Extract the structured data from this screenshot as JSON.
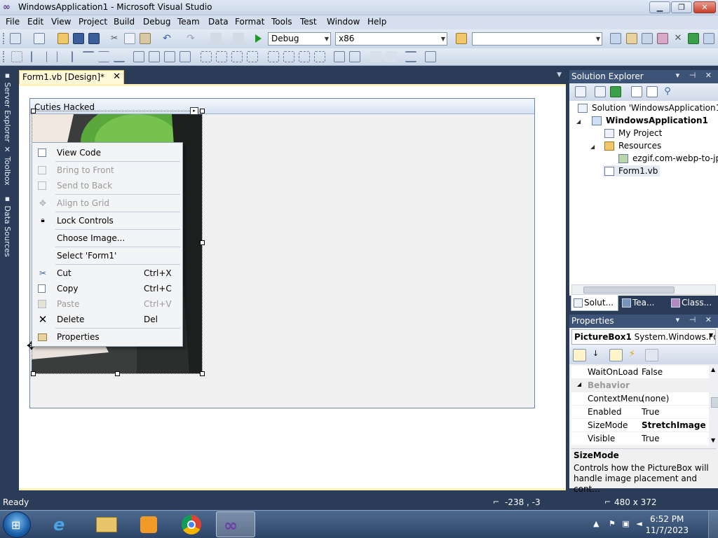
{
  "window": {
    "title": "WindowsApplication1 - Microsoft Visual Studio",
    "minimize_glyph": "▁",
    "maximize_glyph": "❐",
    "close_glyph": "✕"
  },
  "menu": [
    "File",
    "Edit",
    "View",
    "Project",
    "Build",
    "Debug",
    "Team",
    "Data",
    "Format",
    "Tools",
    "Test",
    "Window",
    "Help"
  ],
  "toolbar": {
    "config": "Debug",
    "platform": "x86",
    "find_value": ""
  },
  "side_tabs": [
    "Server Explorer",
    "Toolbox",
    "Data Sources"
  ],
  "document": {
    "tab_label": "Form1.vb [Design]*",
    "tab_close": "✕"
  },
  "form": {
    "caption": "Cuties Hacked"
  },
  "context_menu": {
    "items": [
      {
        "label": "View Code",
        "shortcut": "",
        "enabled": true,
        "icon": "view-code-icon"
      },
      {
        "label": "Bring to Front",
        "shortcut": "",
        "enabled": false,
        "icon": "bring-to-front-icon"
      },
      {
        "label": "Send to Back",
        "shortcut": "",
        "enabled": false,
        "icon": "send-to-back-icon"
      },
      {
        "label": "Align to Grid",
        "shortcut": "",
        "enabled": false,
        "icon": "align-to-grid-icon"
      },
      {
        "label": "Lock Controls",
        "shortcut": "",
        "enabled": true,
        "icon": "lock-icon"
      },
      {
        "label": "Choose Image...",
        "shortcut": "",
        "enabled": true,
        "icon": ""
      },
      {
        "label": "Select 'Form1'",
        "shortcut": "",
        "enabled": true,
        "icon": ""
      },
      {
        "label": "Cut",
        "shortcut": "Ctrl+X",
        "enabled": true,
        "icon": "scissors-icon"
      },
      {
        "label": "Copy",
        "shortcut": "Ctrl+C",
        "enabled": true,
        "icon": "copy-icon"
      },
      {
        "label": "Paste",
        "shortcut": "Ctrl+V",
        "enabled": false,
        "icon": "paste-icon"
      },
      {
        "label": "Delete",
        "shortcut": "Del",
        "enabled": true,
        "icon": "delete-icon"
      },
      {
        "label": "Properties",
        "shortcut": "",
        "enabled": true,
        "icon": "properties-icon"
      }
    ]
  },
  "solution_explorer": {
    "title": "Solution Explorer",
    "header_buttons": "▾ ⊣ ✕",
    "tree": [
      {
        "label": "Solution 'WindowsApplication1'",
        "bold": false
      },
      {
        "label": "WindowsApplication1",
        "bold": true
      },
      {
        "label": "My Project",
        "bold": false
      },
      {
        "label": "Resources",
        "bold": false
      },
      {
        "label": "ezgif.com-webp-to-jp",
        "bold": false
      },
      {
        "label": "Form1.vb",
        "bold": false
      }
    ],
    "tabs": [
      "Solut...",
      "Tea...",
      "Class..."
    ]
  },
  "properties": {
    "title": "Properties",
    "header_buttons": "▾ ⊣ ✕",
    "object_name": "PictureBox1",
    "object_type": "System.Windows.For",
    "rows": [
      {
        "name": "WaitOnLoad",
        "value": "False",
        "category": false,
        "bold": false
      },
      {
        "name": "Behavior",
        "value": "",
        "category": true,
        "bold": false
      },
      {
        "name": "ContextMenu",
        "value": "(none)",
        "category": false,
        "bold": false
      },
      {
        "name": "Enabled",
        "value": "True",
        "category": false,
        "bold": false
      },
      {
        "name": "SizeMode",
        "value": "StretchImage",
        "category": false,
        "bold": true
      },
      {
        "name": "Visible",
        "value": "True",
        "category": false,
        "bold": false
      }
    ],
    "description_title": "SizeMode",
    "description_text": "Controls how the PictureBox will handle image placement and cont..."
  },
  "status": {
    "text": "Ready",
    "position": "-238 , -3",
    "size": "480 x 372"
  },
  "taskbar": {
    "time": "6:52 PM",
    "date": "11/7/2023"
  },
  "colors": {
    "chrome": "#2b3c59",
    "accent_tab": "#fff8d7",
    "pane_header": "#3e5378"
  }
}
